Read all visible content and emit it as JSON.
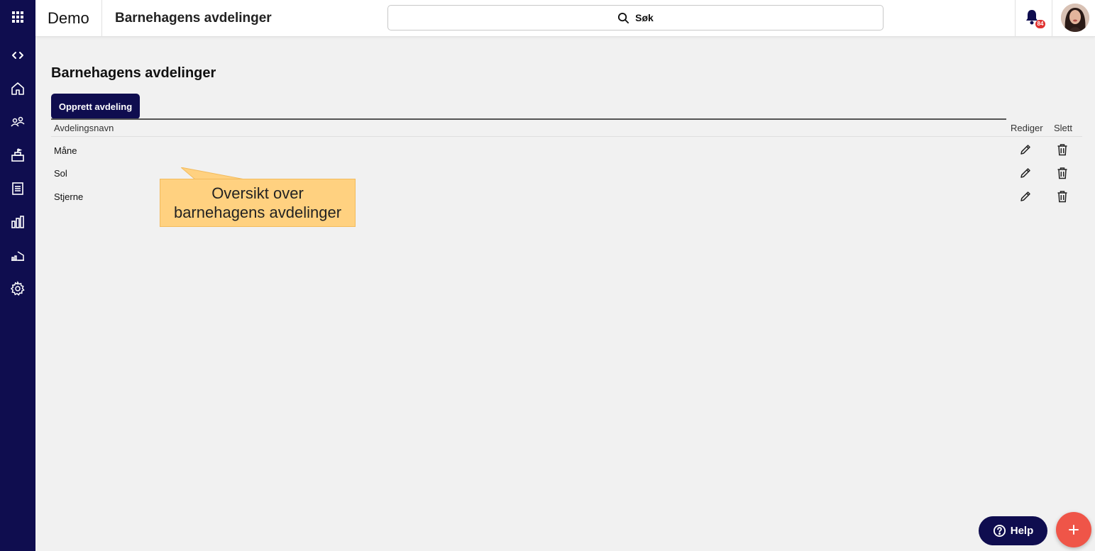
{
  "topbar": {
    "app_name": "Demo",
    "page_title": "Barnehagens avdelinger",
    "search_label": "Søk",
    "notification_count": "84"
  },
  "sidebar": {
    "items": [
      {
        "icon": "apps-grid-icon"
      },
      {
        "icon": "code-toggle-icon"
      },
      {
        "icon": "home-icon"
      },
      {
        "icon": "people-icon"
      },
      {
        "icon": "school-icon"
      },
      {
        "icon": "document-icon"
      },
      {
        "icon": "chart-icon"
      },
      {
        "icon": "building-stats-icon"
      },
      {
        "icon": "gear-icon"
      }
    ]
  },
  "main": {
    "heading": "Barnehagens avdelinger",
    "create_button": "Opprett avdeling",
    "table": {
      "columns": {
        "name": "Avdelingsnavn",
        "edit": "Rediger",
        "delete": "Slett"
      },
      "rows": [
        {
          "name": "Måne"
        },
        {
          "name": "Sol"
        },
        {
          "name": "Stjerne"
        }
      ]
    },
    "callout": {
      "line1": "Oversikt over",
      "line2": "barnehagens avdelinger"
    }
  },
  "footer": {
    "help_label": "Help"
  },
  "colors": {
    "sidebar": "#0f0d4f",
    "accent": "#ef5548",
    "callout": "#ffd180"
  }
}
